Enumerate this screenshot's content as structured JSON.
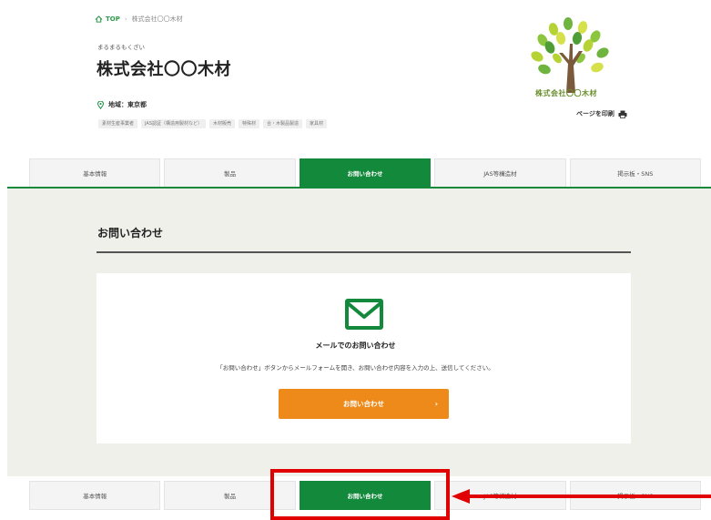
{
  "breadcrumb": {
    "home": "TOP",
    "separator": "›",
    "current": "株式会社〇〇木材"
  },
  "company": {
    "furigana": "まるまるもくざい",
    "name": "株式会社〇〇木材"
  },
  "region": {
    "label": "地域：東京都"
  },
  "tags": [
    "素材生産事業者",
    "JAS認証（構造用製材など）",
    "木材販売",
    "特殊材",
    "合・木製品製造",
    "家具材"
  ],
  "logo": {
    "text": "株式会社〇〇木材"
  },
  "print": {
    "label": "ページを印刷"
  },
  "tabs": [
    {
      "label": "基本情報",
      "active": false
    },
    {
      "label": "製品",
      "active": false
    },
    {
      "label": "お問い合わせ",
      "active": true
    },
    {
      "label": "JAS等構造材",
      "active": false
    },
    {
      "label": "掲示板・SNS",
      "active": false
    }
  ],
  "contact": {
    "heading": "お問い合わせ",
    "mail_title": "メールでのお問い合わせ",
    "description": "「お問い合わせ」ボタンからメールフォームを開き、お問い合わせ内容を入力の上、送信してください。",
    "button_label": "お問い合わせ",
    "button_chevron": "›"
  },
  "colors": {
    "brand_green": "#13893b",
    "cta_orange": "#ee8a1a",
    "highlight_red": "#e00000"
  },
  "icons": {
    "home": "home-icon",
    "pin": "location-pin-icon",
    "printer": "printer-icon",
    "mail": "mail-icon",
    "arrow": "red-arrow-annotation"
  }
}
